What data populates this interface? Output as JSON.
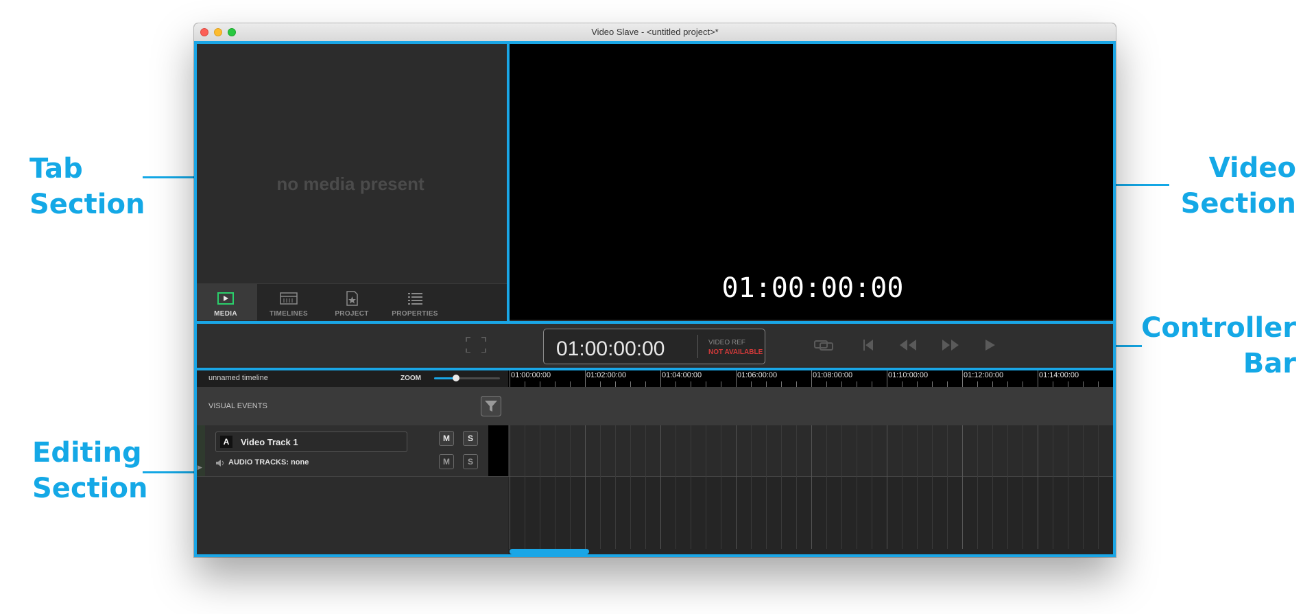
{
  "window": {
    "title": "Video Slave - <untitled project>*"
  },
  "tab_section": {
    "empty_message": "no media present",
    "tabs": [
      {
        "label": "MEDIA",
        "icon": "media-icon",
        "active": true
      },
      {
        "label": "TIMELINES",
        "icon": "timelines-icon",
        "active": false
      },
      {
        "label": "PROJECT",
        "icon": "project-icon",
        "active": false
      },
      {
        "label": "PROPERTIES",
        "icon": "properties-icon",
        "active": false
      }
    ]
  },
  "video": {
    "timecode": "01:00:00:00"
  },
  "controller": {
    "timecode": "01:00:00:00",
    "video_ref_label": "VIDEO REF",
    "video_ref_status": "NOT AVAILABLE",
    "video_ref_status_color": "#d43a3a",
    "icons": [
      "fullscreen-icon",
      "loop-icon",
      "go-to-start-icon",
      "rewind-icon",
      "fast-forward-icon",
      "play-icon"
    ]
  },
  "editing": {
    "timeline_name": "unnamed timeline",
    "zoom_label": "ZOOM",
    "zoom_level": 0.33,
    "visual_events_label": "VISUAL EVENTS",
    "track": {
      "badge": "A",
      "name": "Video Track 1",
      "audio_label": "AUDIO TRACKS: none",
      "mute": "M",
      "solo": "S"
    },
    "ruler": [
      "01:00:00:00",
      "01:02:00:00",
      "01:04:00:00",
      "01:06:00:00",
      "01:08:00:00",
      "01:10:00:00",
      "01:12:00:00",
      "01:14:00:00"
    ]
  },
  "callouts": {
    "tab": [
      "Tab",
      "Section"
    ],
    "video": [
      "Video",
      "Section"
    ],
    "controller": [
      "Controller",
      "Bar"
    ],
    "editing": [
      "Editing",
      "Section"
    ]
  },
  "accent_color": "#1aa6e6"
}
